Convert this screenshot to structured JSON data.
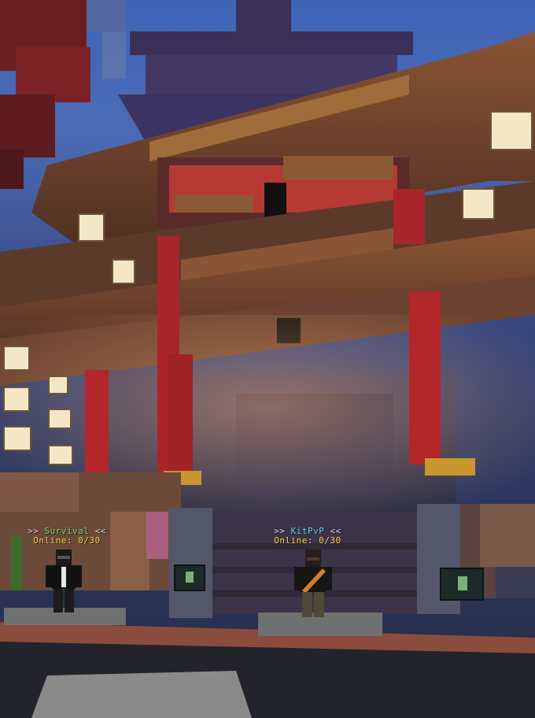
{
  "scene": "minecraft-lobby-pagoda",
  "colors": {
    "sky": "#3f63b8",
    "wood": "#7a4a2f",
    "red_pillar": "#b3262a",
    "lantern": "#f3e7c6",
    "stone": "#4a4d5c",
    "floor": "#5a3a2f",
    "survival_name": "#7cd36b",
    "kitpvp_name": "#59d2e8",
    "online_text": "#ffd24a"
  },
  "npcs": [
    {
      "name": "Survival",
      "prefix": ">>",
      "suffix": "<<",
      "online_label": "Online: 0/30",
      "name_color": "#7cd36b"
    },
    {
      "name": "KitPvP",
      "prefix": ">>",
      "suffix": "<<",
      "online_label": "Online: 0/30",
      "name_color": "#59d2e8"
    }
  ]
}
